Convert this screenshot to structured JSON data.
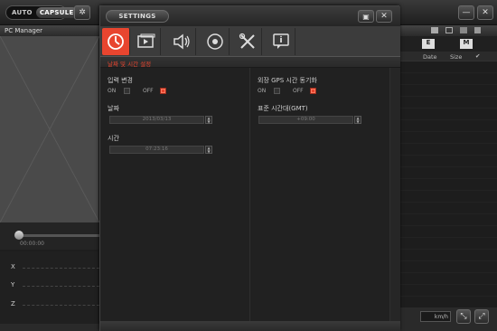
{
  "titlebar": {
    "mode_auto": "AUTO",
    "mode_capsule": "CAPSULE",
    "minimize": "—",
    "close": "✕"
  },
  "left": {
    "pc_manager": "PC Manager",
    "seek_time": "00:00:00",
    "graph_axes": [
      "X",
      "Y",
      "Z"
    ]
  },
  "right": {
    "col_e": "E",
    "col_m": "M",
    "headers": [
      "Date",
      "Size"
    ],
    "speed_unit": "km/h"
  },
  "settings": {
    "title": "SETTINGS",
    "tabs": [
      "clock-icon",
      "video-icon",
      "speaker-icon",
      "record-icon",
      "tools-icon",
      "info-icon"
    ],
    "section_title": "날짜 및 시간 설정",
    "input_change": {
      "label": "입력 변경",
      "on": "ON",
      "off": "OFF",
      "selected": "OFF"
    },
    "date": {
      "label": "날짜",
      "value": "2013/03/13"
    },
    "time": {
      "label": "시간",
      "value": "07:23:16"
    },
    "gps_sync": {
      "label": "외장 GPS 시간 동기화",
      "on": "ON",
      "off": "OFF",
      "selected": "OFF"
    },
    "timezone": {
      "label": "표준 시간대(GMT)",
      "value": "+09:00"
    }
  },
  "colors": {
    "accent": "#e8452f"
  }
}
